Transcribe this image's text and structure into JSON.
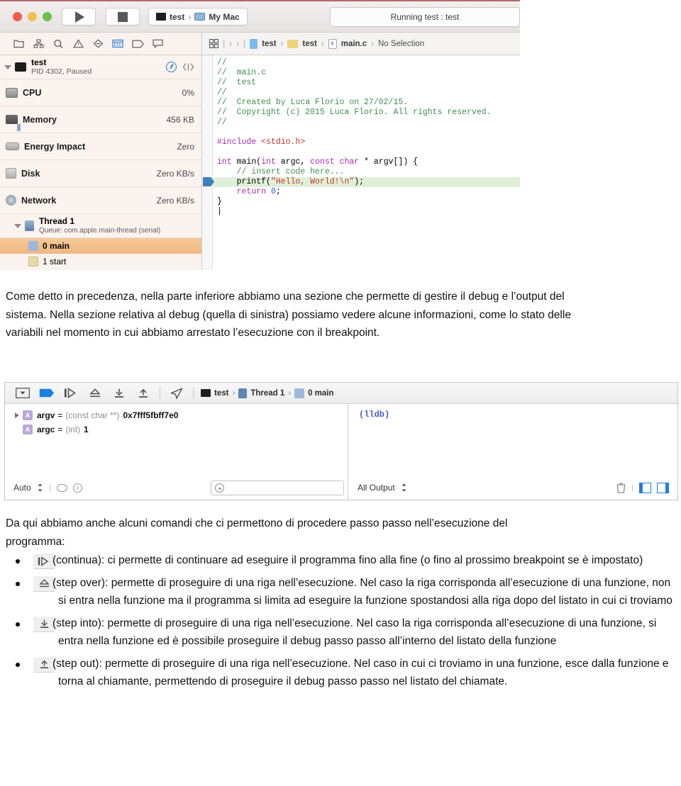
{
  "shot1": {
    "titlebar": {
      "run_button": "run-play",
      "stop_button": "stop-square",
      "scheme": "test",
      "destination": "My Mac",
      "separator": "›",
      "status": "Running test : test"
    },
    "navigator_icons": [
      {
        "name": "project-navigator-icon",
        "selected": false
      },
      {
        "name": "symbol-navigator-icon",
        "selected": false
      },
      {
        "name": "search-navigator-icon",
        "selected": false
      },
      {
        "name": "issue-navigator-icon",
        "selected": false
      },
      {
        "name": "test-navigator-icon",
        "selected": false
      },
      {
        "name": "debug-navigator-icon",
        "selected": true
      },
      {
        "name": "breakpoint-navigator-icon",
        "selected": false
      },
      {
        "name": "report-navigator-icon",
        "selected": false
      }
    ],
    "breadcrumb": {
      "back": "‹",
      "forward": "›",
      "items": [
        "test",
        "test",
        "main.c",
        "No Selection"
      ],
      "sep": "›"
    },
    "process": {
      "name": "test",
      "detail": "PID 4302, Paused"
    },
    "gauges": [
      {
        "label": "CPU",
        "value": "0%"
      },
      {
        "label": "Memory",
        "value": "456 KB"
      },
      {
        "label": "Energy Impact",
        "value": "Zero"
      },
      {
        "label": "Disk",
        "value": "Zero KB/s"
      },
      {
        "label": "Network",
        "value": "Zero KB/s"
      }
    ],
    "thread": {
      "title": "Thread 1",
      "queue": "Queue: com.apple.main-thread (serial)",
      "frames": [
        {
          "label": "0 main",
          "selected": true
        },
        {
          "label": "1 start",
          "selected": false
        }
      ]
    },
    "code_lines": [
      [
        {
          "t": "//",
          "c": "cm"
        }
      ],
      [
        {
          "t": "//  main.c",
          "c": "cm"
        }
      ],
      [
        {
          "t": "//  test",
          "c": "cm"
        }
      ],
      [
        {
          "t": "//",
          "c": "cm"
        }
      ],
      [
        {
          "t": "//  Created by Luca Florio on 27/02/15.",
          "c": "cm"
        }
      ],
      [
        {
          "t": "//  Copyright (c) 2015 Luca Florio. All rights reserved.",
          "c": "cm"
        }
      ],
      [
        {
          "t": "//",
          "c": "cm"
        }
      ],
      [
        {
          "t": "",
          "c": ""
        }
      ],
      [
        {
          "t": "#include ",
          "c": "pp"
        },
        {
          "t": "<stdio.h>",
          "c": "pre-h"
        }
      ],
      [
        {
          "t": "",
          "c": ""
        }
      ],
      [
        {
          "t": "int",
          "c": "kw"
        },
        {
          "t": " main(",
          "c": "fn"
        },
        {
          "t": "int",
          "c": "kw"
        },
        {
          "t": " argc, ",
          "c": "fn"
        },
        {
          "t": "const",
          "c": "kw"
        },
        {
          "t": " ",
          "c": "fn"
        },
        {
          "t": "char",
          "c": "kw"
        },
        {
          "t": " * argv[]) {",
          "c": "fn"
        }
      ],
      [
        {
          "t": "    // insert code here...",
          "c": "cm"
        }
      ],
      [
        {
          "t": "    printf(",
          "c": "fn"
        },
        {
          "t": "\"Hello, World!\\n\"",
          "c": "str"
        },
        {
          "t": ");",
          "c": "fn"
        }
      ],
      [
        {
          "t": "    ",
          "c": "fn"
        },
        {
          "t": "return",
          "c": "kw"
        },
        {
          "t": " ",
          "c": "fn"
        },
        {
          "t": "0",
          "c": "num"
        },
        {
          "t": ";",
          "c": "fn"
        }
      ],
      [
        {
          "t": "}",
          "c": "fn"
        }
      ],
      [
        {
          "t": "|",
          "c": "fn"
        }
      ]
    ],
    "highlighted_line_index": 12
  },
  "paragraph1": "Come detto in precedenza, nella parte inferiore abbiamo una sezione che permette di gestire il debug e l’output del sistema. Nella sezione relativa al debug (quella di sinistra) possiamo vedere alcune informazioni, come lo stato delle variabili nel momento in cui abbiamo arrestato l’esecuzione con il breakpoint.",
  "shot2": {
    "toolbar_icons": [
      {
        "name": "hide-debug-area-icon"
      },
      {
        "name": "deactivate-breakpoints-icon"
      },
      {
        "name": "continue-icon"
      },
      {
        "name": "step-over-icon"
      },
      {
        "name": "step-into-icon"
      },
      {
        "name": "step-out-icon"
      },
      {
        "name": "simulate-location-icon"
      }
    ],
    "crumbs": [
      "test",
      "Thread 1",
      "0 main"
    ],
    "crumb_sep": "›",
    "variables": [
      {
        "badge": "A",
        "name": "argv",
        "type": "(const char **)",
        "value": "0x7fff5fbff7e0",
        "expandable": true
      },
      {
        "badge": "A",
        "name": "argc",
        "type": "(int)",
        "value": "1",
        "expandable": false
      }
    ],
    "console_prompt": "(lldb)",
    "scope_filter": "Auto",
    "output_filter": "All Output",
    "stepper_glyph": "⌃",
    "console_placeholder": ""
  },
  "paragraph2": "Da qui abbiamo anche alcuni comandi che ci permettono di procedere passo passo nell’esecuzione del programma:",
  "bullets": [
    {
      "icon": "continue-icon",
      "text": "(continua): ci permette di continuare ad eseguire il programma fino alla fine (o fino al prossimo breakpoint se è impostato)"
    },
    {
      "icon": "step-over-icon",
      "text": "(step over): permette di proseguire di una riga nell’esecuzione. Nel caso la riga corrisponda all’esecuzione di una funzione, non si entra nella funzione ma il programma si limita ad eseguire la funzione spostandosi alla riga dopo del listato in cui ci troviamo"
    },
    {
      "icon": "step-into-icon",
      "text": "(step into): permette di proseguire di una riga nell’esecuzione. Nel caso la riga corrisponda all’esecuzione di una funzione, si entra nella funzione ed è possibile proseguire il debug passo passo all’interno del listato della funzione"
    },
    {
      "icon": "step-out-icon",
      "text": "(step out): permette di proseguire di una riga nell’esecuzione. Nel caso in cui ci troviamo in una funzione, esce dalla funzione e torna al chiamante, permettendo di proseguire il debug passo passo nel listato del chiamate."
    }
  ],
  "colors": {
    "accent_blue": "#2a7fd4",
    "comment_green": "#3f8f50",
    "keyword_purple": "#aa2bb0",
    "string_red": "#c7342d",
    "highlight_green": "#dff0d8",
    "selection_orange": "#f0b882"
  }
}
